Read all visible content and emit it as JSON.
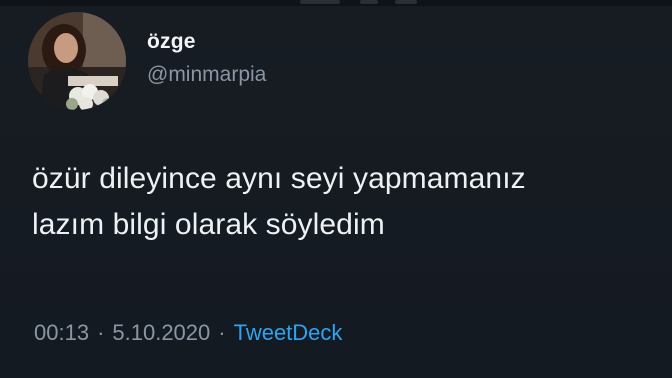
{
  "colors": {
    "background": "#161b22",
    "text_primary": "#eef1f4",
    "text_secondary": "#8a96a3",
    "link": "#2ea3f2"
  },
  "author": {
    "avatar_icon": "profile-photo",
    "display_name": "özge",
    "handle": "@minmarpia"
  },
  "tweet": {
    "text_lines": [
      "özür dileyince aynı seyi yapmamanız",
      "lazım bilgi olarak söyledim"
    ]
  },
  "meta": {
    "time": "00:13",
    "separator": "·",
    "date": "5.10.2020",
    "source": "TweetDeck"
  }
}
